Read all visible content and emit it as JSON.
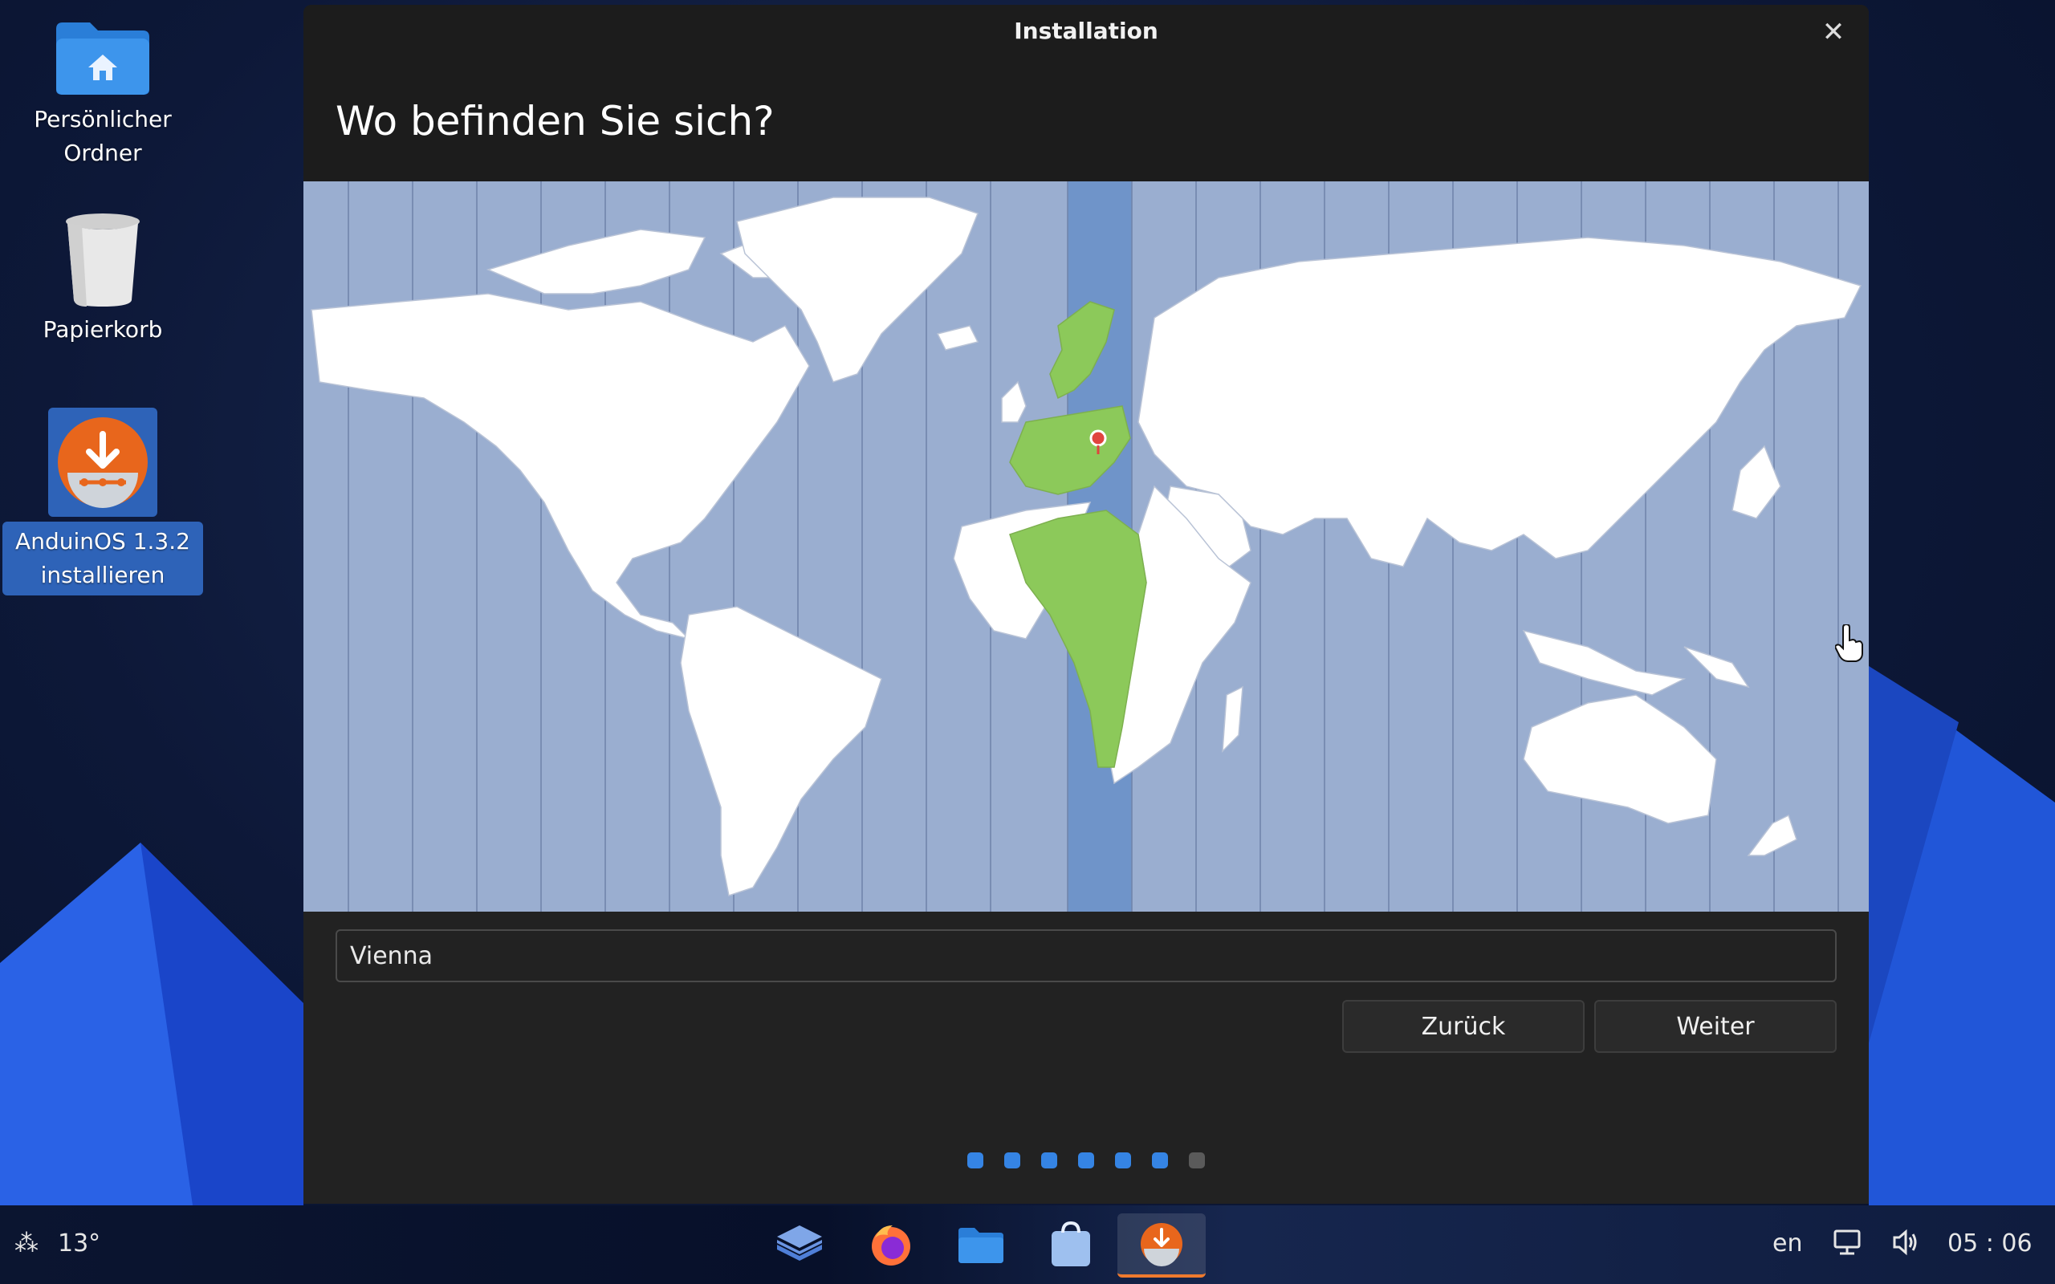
{
  "desktop": {
    "icons": [
      {
        "label": "Persönlicher Ordner"
      },
      {
        "label": "Papierkorb"
      },
      {
        "label": "AnduinOS 1.3.2 installieren"
      }
    ]
  },
  "window": {
    "title": "Installation",
    "heading": "Wo befinden Sie sich?",
    "city_value": "Vienna",
    "back_label": "Zurück",
    "next_label": "Weiter",
    "steps_total": 7,
    "steps_active": 6
  },
  "taskbar": {
    "weather_temp": "13°",
    "apps": [
      {
        "icon": "layers-icon"
      },
      {
        "icon": "firefox-icon"
      },
      {
        "icon": "files-icon"
      },
      {
        "icon": "software-store-icon"
      },
      {
        "icon": "installer-icon",
        "active": true
      }
    ],
    "keyboard_layout": "en",
    "clock": "05 : 06"
  },
  "colors": {
    "accent": "#3584e4",
    "map_ocean": "#9aaed0",
    "selected_zone": "#6f94c9",
    "selected_region": "#8cc95a",
    "installer_orange": "#e8661c"
  }
}
